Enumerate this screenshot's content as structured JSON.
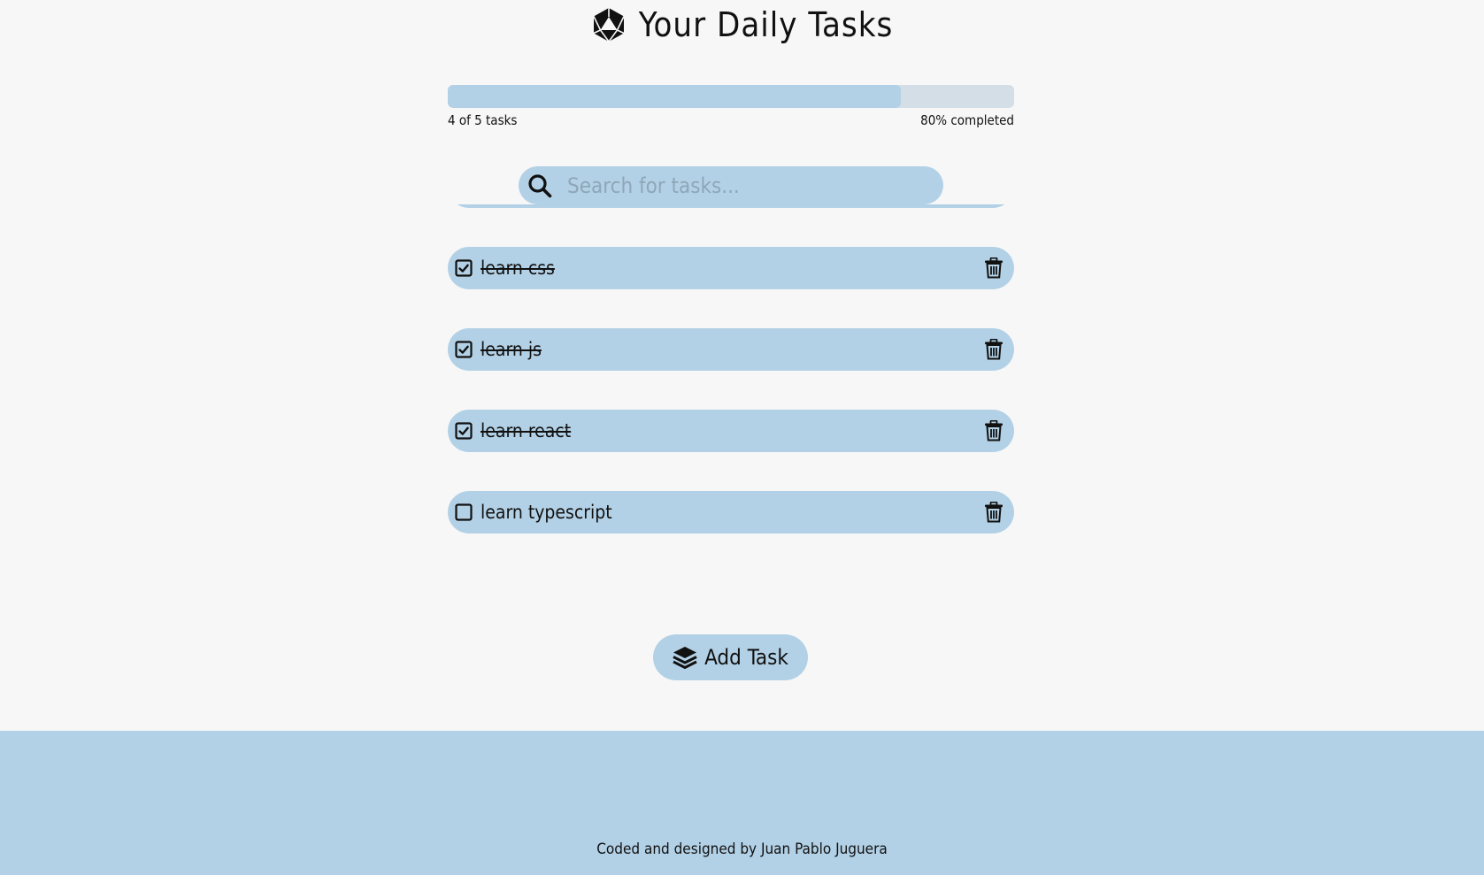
{
  "header": {
    "title": "Your Daily Tasks",
    "logo_icon": "dice-d20-icon"
  },
  "progress": {
    "completed": 4,
    "total": 5,
    "fraction": 0.8,
    "count_label": "4 of 5 tasks",
    "percent_label": "80% completed"
  },
  "search": {
    "placeholder": "Search for tasks...",
    "value": "",
    "icon": "search-icon"
  },
  "tasks": [
    {
      "label": "",
      "done": true
    },
    {
      "label": "learn css",
      "done": true
    },
    {
      "label": "learn js",
      "done": true
    },
    {
      "label": "learn react",
      "done": true
    },
    {
      "label": "learn typescript",
      "done": false
    }
  ],
  "add_button": {
    "label": "Add Task",
    "icon": "layers-icon"
  },
  "footer": {
    "credit": "Coded and designed by Juan Pablo Juguera"
  },
  "colors": {
    "background": "#f7f7f7",
    "accent": "#b3d1e6",
    "progress_track": "#d3dee7",
    "text": "#111111"
  }
}
